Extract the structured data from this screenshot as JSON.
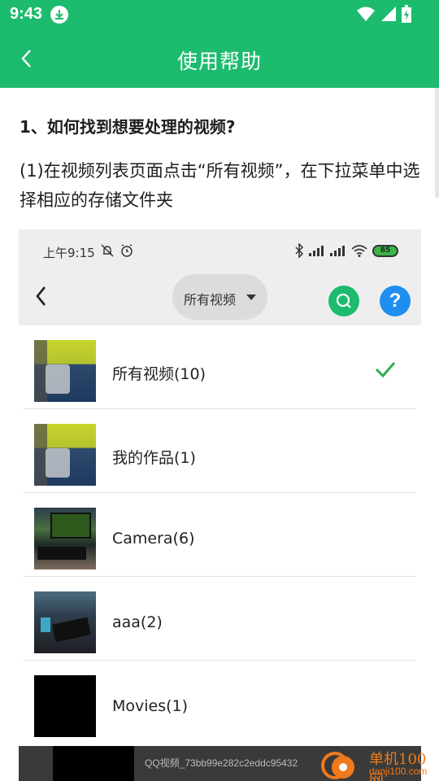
{
  "status_bar": {
    "time": "9:43",
    "icons": [
      "download-icon",
      "wifi-icon",
      "signal-icon",
      "battery-charging-icon"
    ]
  },
  "app_bar": {
    "title": "使用帮助",
    "back_icon": "chevron-left-icon"
  },
  "help": {
    "heading": "1、如何找到想要处理的视频?",
    "instruction": "(1)在视频列表页面点击“所有视频”，在下拉菜单中选择相应的存储文件夹"
  },
  "embedded_screenshot": {
    "status_time": "上午9:15",
    "battery_level": "85",
    "dropdown_label": "所有视频",
    "folders": [
      {
        "name": "所有视频(10)",
        "selected": true
      },
      {
        "name": "我的作品(1)",
        "selected": false
      },
      {
        "name": "Camera(6)",
        "selected": false
      },
      {
        "name": "aaa(2)",
        "selected": false
      },
      {
        "name": "Movies(1)",
        "selected": false
      }
    ],
    "bottom_caption": "QQ视频_73bb99e282c2eddc95432"
  },
  "watermark": {
    "cn": "单机100网",
    "en": "danji100.com"
  },
  "colors": {
    "brand_green": "#1dbb6e",
    "help_blue": "#1e8ff0",
    "watermark_orange": "#f07a1b"
  }
}
